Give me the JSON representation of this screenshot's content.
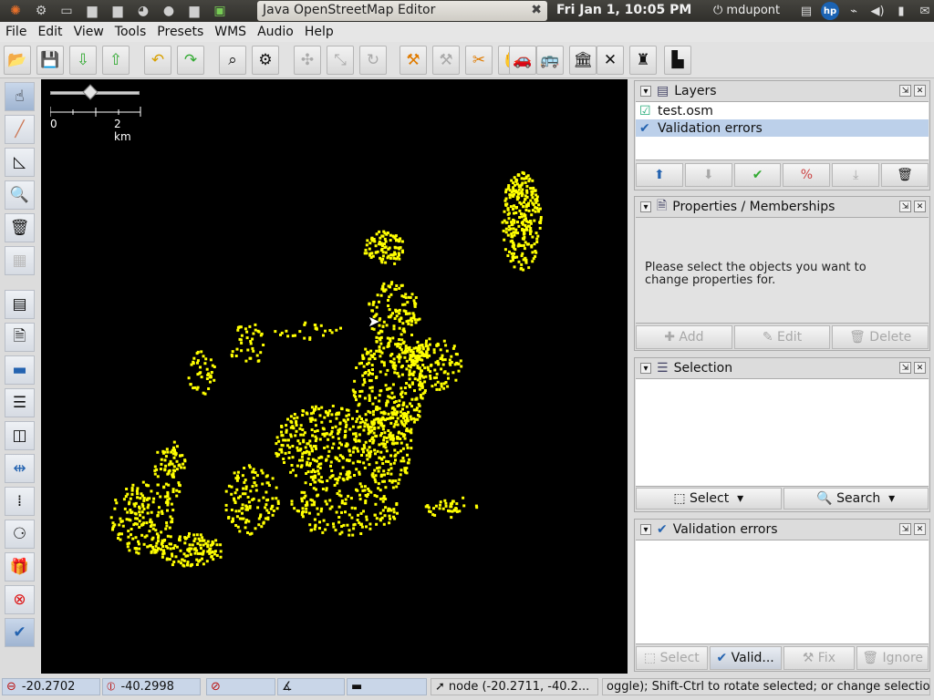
{
  "topbar": {
    "task_title": "Java OpenStreetMap Editor",
    "clock": "Fri Jan  1, 10:05 PM",
    "user": "mdupont"
  },
  "menu": [
    "File",
    "Edit",
    "View",
    "Tools",
    "Presets",
    "WMS",
    "Audio",
    "Help"
  ],
  "map": {
    "scale_start": "0",
    "scale_end": "2 km",
    "background": "#000000",
    "point_color": "#ffff00"
  },
  "layers_panel": {
    "title": "Layers",
    "items": [
      "test.osm",
      "Validation errors"
    ]
  },
  "properties_panel": {
    "title": "Properties / Memberships",
    "message_line1": "Please select the objects you want to",
    "message_line2": "change properties for.",
    "buttons": [
      "Add",
      "Edit",
      "Delete"
    ]
  },
  "selection_panel": {
    "title": "Selection",
    "buttons": [
      "Select",
      "Search"
    ]
  },
  "validation_panel": {
    "title": "Validation errors",
    "buttons": [
      "Select",
      "Valid...",
      "Fix",
      "Ignore"
    ]
  },
  "status": {
    "lat": "-20.2702",
    "lon": "-40.2998",
    "heading": "",
    "angle": "",
    "distance": "",
    "node": "node (-20.2711, -40.2...",
    "help": "oggle); Shift-Ctrl to rotate selected; or change selection"
  }
}
